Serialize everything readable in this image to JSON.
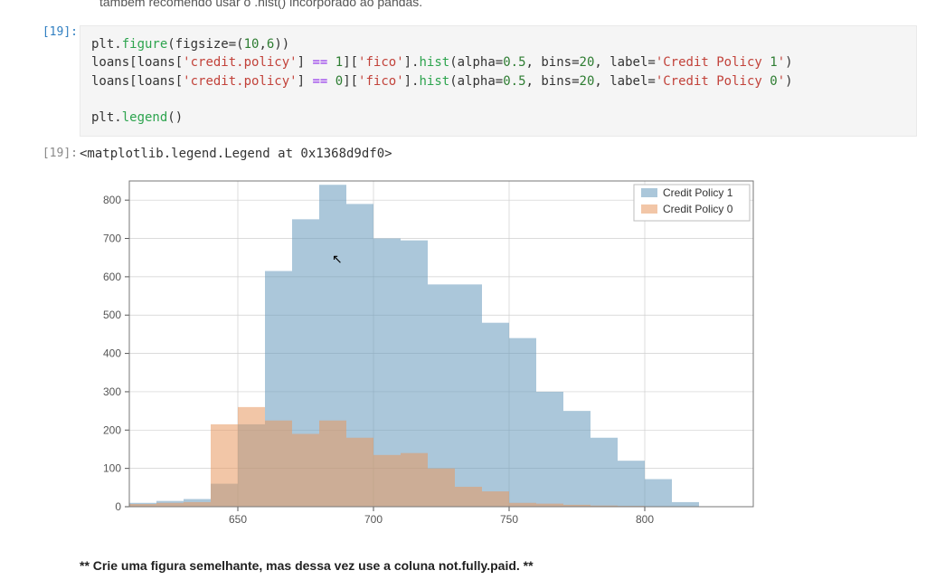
{
  "top_truncated_text": "também recomendo usar o .hist() incorporado ao pandas.",
  "cells": {
    "input": {
      "prompt": "[19]:",
      "code_plain": "plt.figure(figsize=(10,6))\nloans[loans['credit.policy'] == 1]['fico'].hist(alpha=0.5, bins=20, label='Credit Policy 1')\nloans[loans['credit.policy'] == 0]['fico'].hist(alpha=0.5, bins=20, label='Credit Policy 0')\n\nplt.legend()"
    },
    "output": {
      "prompt": "[19]:",
      "repr": "<matplotlib.legend.Legend at 0x1368d9df0>"
    }
  },
  "bottom_note": "** Crie uma figura semelhante, mas dessa vez use a coluna not.fully.paid. **",
  "chart_data": {
    "type": "bar",
    "title": "",
    "xlabel": "",
    "ylabel": "",
    "xlim": [
      610,
      840
    ],
    "ylim": [
      0,
      850
    ],
    "x_ticks": [
      650,
      700,
      750,
      800
    ],
    "y_ticks": [
      0,
      100,
      200,
      300,
      400,
      500,
      600,
      700,
      800
    ],
    "bin_width": 10,
    "categories": [
      615,
      625,
      635,
      645,
      655,
      665,
      675,
      685,
      695,
      705,
      715,
      725,
      735,
      745,
      755,
      765,
      775,
      785,
      795,
      805,
      815,
      825
    ],
    "series": [
      {
        "name": "Credit Policy 1",
        "color": "#6699bb",
        "alpha": 0.55,
        "values": [
          10,
          15,
          20,
          60,
          215,
          615,
          750,
          840,
          790,
          700,
          695,
          580,
          580,
          480,
          440,
          300,
          250,
          180,
          120,
          72,
          12,
          0
        ]
      },
      {
        "name": "Credit Policy 0",
        "color": "#e8985e",
        "alpha": 0.55,
        "values": [
          7,
          10,
          12,
          215,
          260,
          225,
          190,
          225,
          180,
          135,
          140,
          100,
          52,
          40,
          10,
          8,
          5,
          3,
          2,
          1,
          0,
          0
        ]
      }
    ],
    "legend_position": "upper right"
  }
}
